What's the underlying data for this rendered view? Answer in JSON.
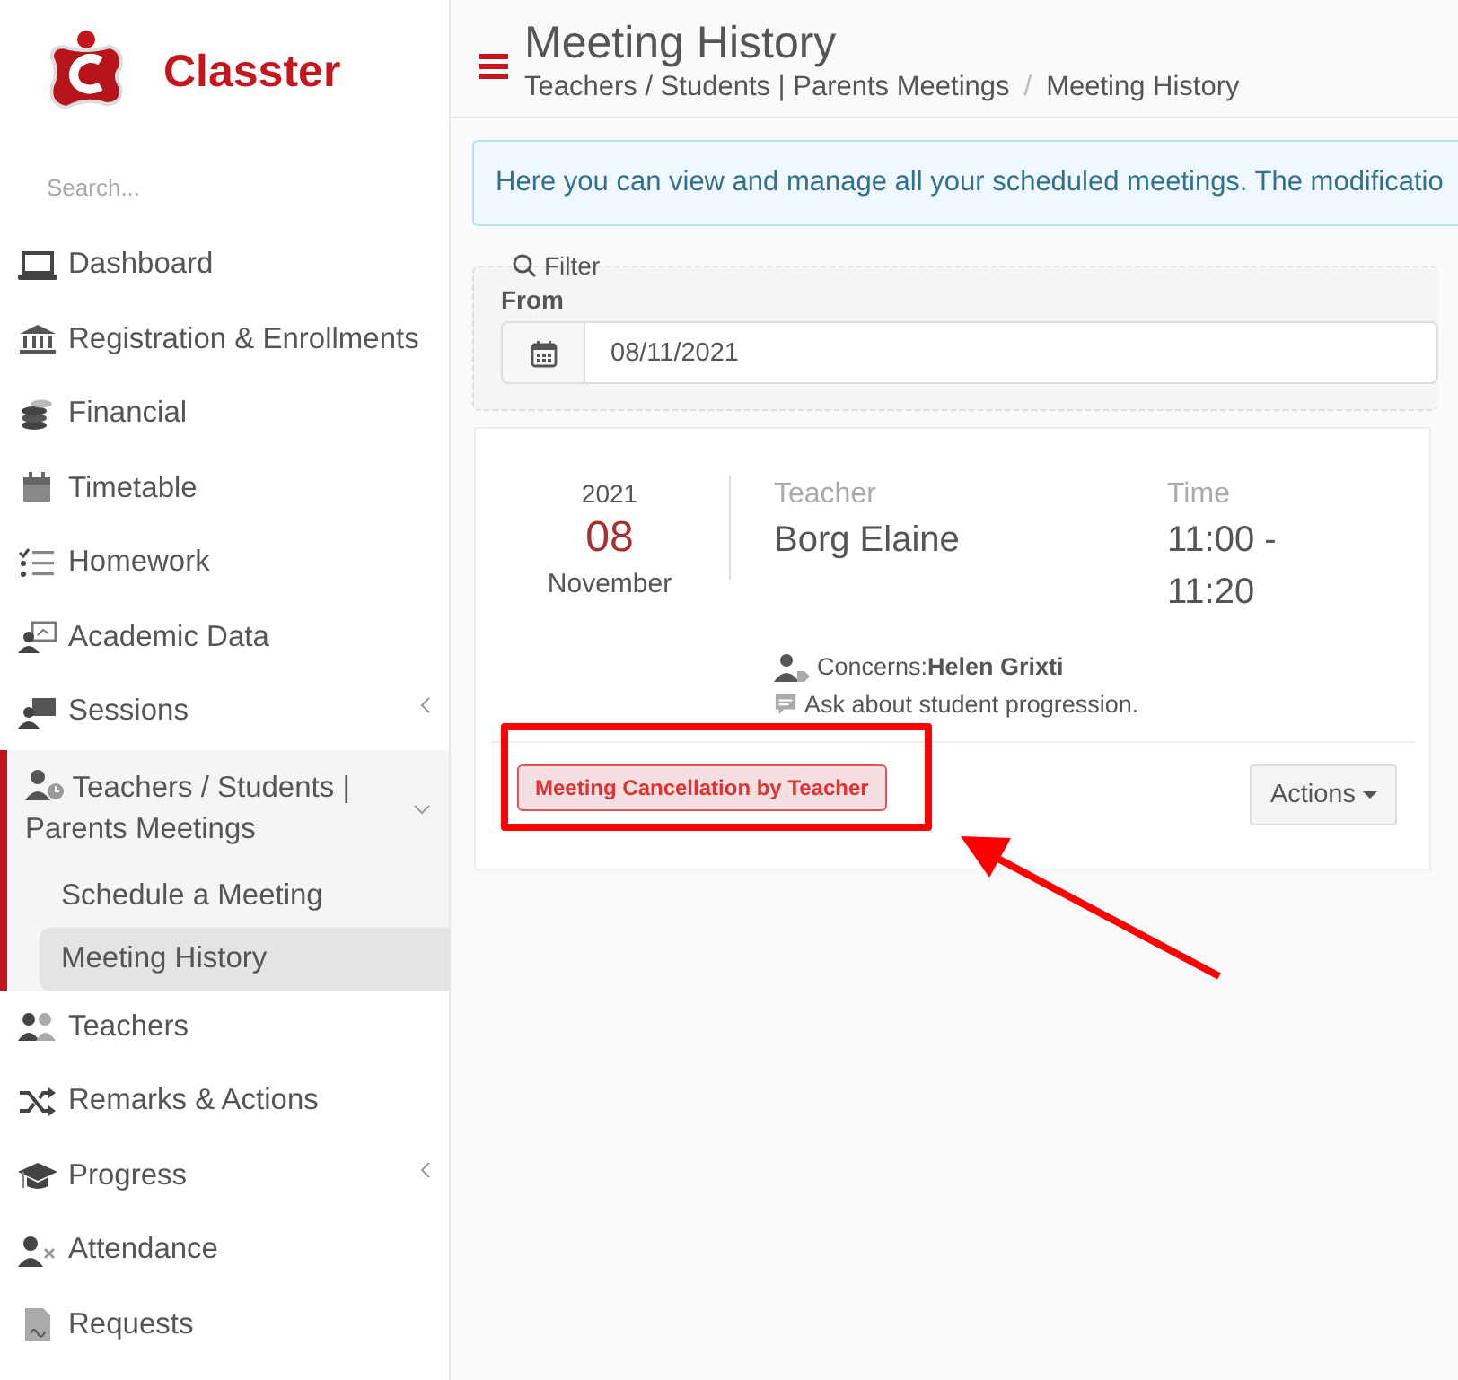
{
  "logo": {
    "name": "Classter"
  },
  "sidebar": {
    "search": {
      "placeholder": "Search..."
    },
    "items": [
      {
        "label": "Dashboard",
        "kind": "link",
        "selected": false
      },
      {
        "label": "Registration & Enrollments",
        "kind": "group",
        "expanded": false,
        "selected": false
      },
      {
        "label": "Financial",
        "kind": "link",
        "selected": false
      },
      {
        "label": "Timetable",
        "kind": "link",
        "selected": false
      },
      {
        "label": "Homework",
        "kind": "link",
        "selected": false
      },
      {
        "label": "Academic Data",
        "kind": "link",
        "selected": false
      },
      {
        "label": "Sessions",
        "kind": "group",
        "expanded": false,
        "selected": false
      },
      {
        "label": "Teachers / Students | Parents Meetings",
        "kind": "group",
        "expanded": true,
        "selected": true,
        "children": [
          {
            "label": "Schedule a Meeting",
            "selected": false
          },
          {
            "label": "Meeting History",
            "selected": true
          }
        ]
      },
      {
        "label": "Teachers",
        "kind": "link",
        "selected": false
      },
      {
        "label": "Remarks & Actions",
        "kind": "link",
        "selected": false
      },
      {
        "label": "Progress",
        "kind": "group",
        "expanded": false,
        "selected": false
      },
      {
        "label": "Attendance",
        "kind": "link",
        "selected": false
      },
      {
        "label": "Requests",
        "kind": "link",
        "selected": false
      }
    ]
  },
  "header": {
    "title": "Meeting History",
    "breadcrumb": [
      "Teachers / Students | Parents Meetings",
      "Meeting History"
    ],
    "breadcrumb_separator": "/"
  },
  "alert": {
    "text": "Here you can view and manage all your scheduled meetings. The modificatio"
  },
  "filter": {
    "legend": "Filter",
    "from_label": "From",
    "from_value": "08/11/2021"
  },
  "meetings": [
    {
      "year": "2021",
      "day": "08",
      "month": "November",
      "teacher_label": "Teacher",
      "teacher": "Borg Elaine",
      "time_label": "Time",
      "time": "11:00 - 11:20",
      "concerns_label": "Concerns:",
      "concerns": "Helen Grixti",
      "note": "Ask about student progression.",
      "status": "Meeting Cancellation by Teacher",
      "actions": "Actions"
    }
  ]
}
